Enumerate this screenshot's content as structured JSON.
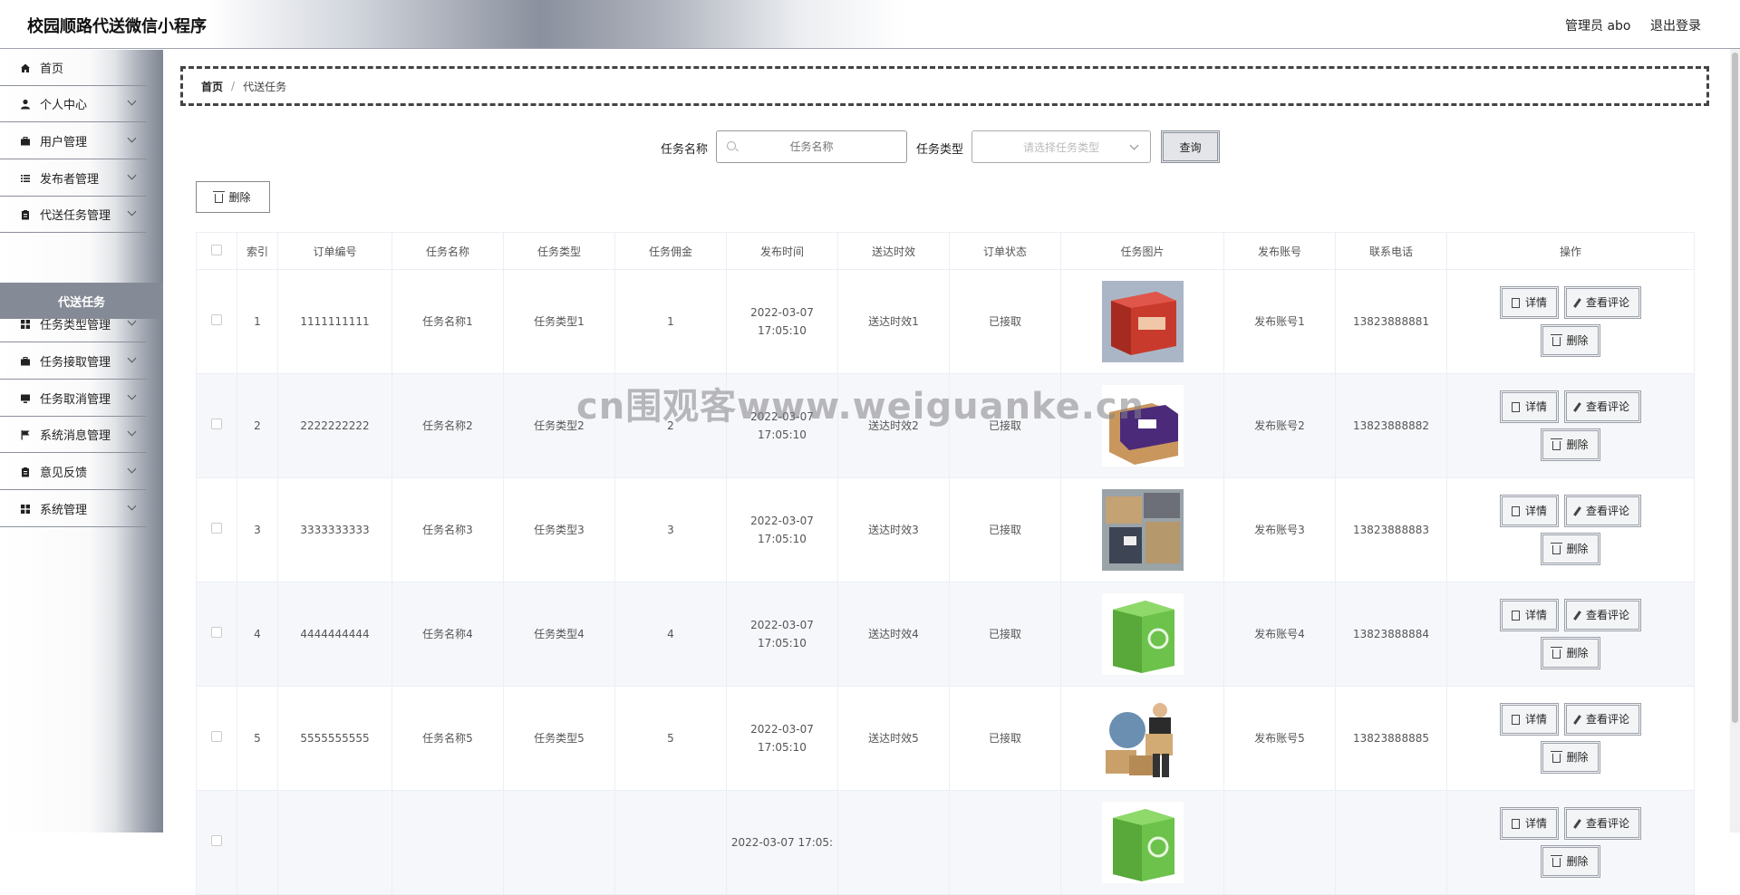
{
  "header": {
    "title": "校园顺路代送微信小程序",
    "admin": "管理员 abo",
    "logout": "退出登录"
  },
  "sidebar": {
    "items": [
      {
        "label": "首页",
        "icon": "home-icon",
        "has_chevron": false
      },
      {
        "label": "个人中心",
        "icon": "user-icon",
        "has_chevron": true
      },
      {
        "label": "用户管理",
        "icon": "briefcase-icon",
        "has_chevron": true
      },
      {
        "label": "发布者管理",
        "icon": "list-icon",
        "has_chevron": true
      },
      {
        "label": "代送任务管理",
        "icon": "clipboard-icon",
        "has_chevron": true
      },
      {
        "label": "任务类型管理",
        "icon": "grid-icon",
        "has_chevron": true
      },
      {
        "label": "任务接取管理",
        "icon": "briefcase-icon",
        "has_chevron": true
      },
      {
        "label": "任务取消管理",
        "icon": "monitor-icon",
        "has_chevron": true
      },
      {
        "label": "系统消息管理",
        "icon": "flag-icon",
        "has_chevron": true
      },
      {
        "label": "意见反馈",
        "icon": "clipboard-icon",
        "has_chevron": true
      },
      {
        "label": "系统管理",
        "icon": "grid-icon",
        "has_chevron": true
      }
    ],
    "active_sub": "代送任务"
  },
  "breadcrumb": {
    "home": "首页",
    "separator": "/",
    "current": "代送任务"
  },
  "search": {
    "name_label": "任务名称",
    "name_placeholder": "任务名称",
    "type_label": "任务类型",
    "type_placeholder": "请选择任务类型",
    "query_button": "查询"
  },
  "toolbar": {
    "delete_label": "删除"
  },
  "table": {
    "columns": [
      "索引",
      "订单编号",
      "任务名称",
      "任务类型",
      "任务佣金",
      "发布时间",
      "送达时效",
      "订单状态",
      "任务图片",
      "发布账号",
      "联系电话",
      "操作"
    ],
    "rows": [
      {
        "index": "1",
        "order_no": "1111111111",
        "name": "任务名称1",
        "type": "任务类型1",
        "fee": "1",
        "time": "2022-03-07 17:05:10",
        "timeliness": "送达时效1",
        "status": "已接取",
        "image": "red-box",
        "account": "发布账号1",
        "phone": "13823888881"
      },
      {
        "index": "2",
        "order_no": "2222222222",
        "name": "任务名称2",
        "type": "任务类型2",
        "fee": "2",
        "time": "2022-03-07 17:05:10",
        "timeliness": "送达时效2",
        "status": "已接取",
        "image": "purple-box",
        "account": "发布账号2",
        "phone": "13823888882"
      },
      {
        "index": "3",
        "order_no": "3333333333",
        "name": "任务名称3",
        "type": "任务类型3",
        "fee": "3",
        "time": "2022-03-07 17:05:10",
        "timeliness": "送达时效3",
        "status": "已接取",
        "image": "parcel-pile",
        "account": "发布账号3",
        "phone": "13823888883"
      },
      {
        "index": "4",
        "order_no": "4444444444",
        "name": "任务名称4",
        "type": "任务类型4",
        "fee": "4",
        "time": "2022-03-07 17:05:10",
        "timeliness": "送达时效4",
        "status": "已接取",
        "image": "green-box",
        "account": "发布账号4",
        "phone": "13823888884"
      },
      {
        "index": "5",
        "order_no": "5555555555",
        "name": "任务名称5",
        "type": "任务类型5",
        "fee": "5",
        "time": "2022-03-07 17:05:10",
        "timeliness": "送达时效5",
        "status": "已接取",
        "image": "courier",
        "account": "发布账号5",
        "phone": "13823888885"
      },
      {
        "index": "",
        "order_no": "",
        "name": "",
        "type": "",
        "fee": "",
        "time": "2022-03-07 17:05:",
        "timeliness": "",
        "status": "",
        "image": "green-box",
        "account": "",
        "phone": ""
      }
    ],
    "actions": {
      "detail": "详情",
      "comments": "查看评论",
      "delete": "删除"
    }
  },
  "watermark": "cn围观客www.weiguanke.cn"
}
